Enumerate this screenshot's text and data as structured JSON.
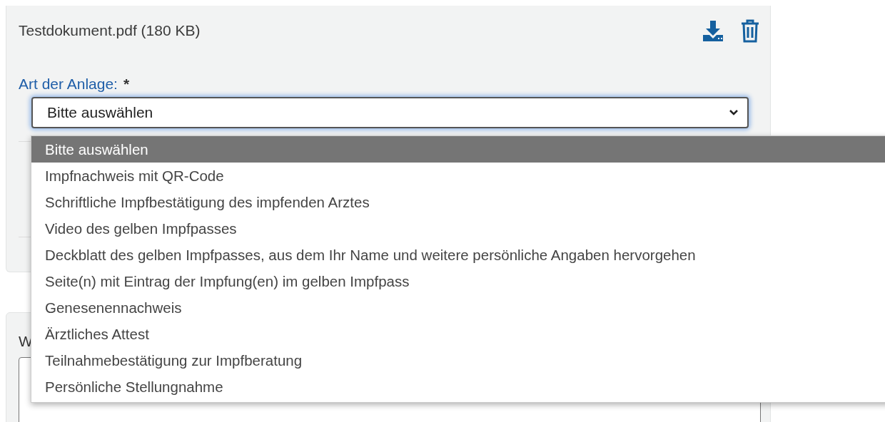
{
  "attachment": {
    "file": "Testdokument.pdf (180 KB)"
  },
  "field": {
    "label": "Art der Anlage:",
    "required_mark": "*",
    "value": "Bitte auswählen",
    "expanded": true
  },
  "options": [
    {
      "label": "Bitte auswählen",
      "selected": true
    },
    {
      "label": "Impfnachweis mit QR-Code",
      "selected": false
    },
    {
      "label": "Schriftliche Impfbestätigung des impfenden Arztes",
      "selected": false
    },
    {
      "label": "Video des gelben Impfpasses",
      "selected": false
    },
    {
      "label": "Deckblatt des gelben Impfpasses, aus dem Ihr Name und weitere persönliche Angaben hervorgehen",
      "selected": false
    },
    {
      "label": "Seite(n) mit Eintrag der Impfung(en) im gelben Impfpass",
      "selected": false
    },
    {
      "label": "Genesenennachweis",
      "selected": false
    },
    {
      "label": "Ärztliches Attest",
      "selected": false
    },
    {
      "label": "Teilnahmebestätigung zur Impfberatung",
      "selected": false
    },
    {
      "label": "Persönliche Stellungnahme",
      "selected": false
    }
  ],
  "second_section": {
    "label": "W"
  }
}
